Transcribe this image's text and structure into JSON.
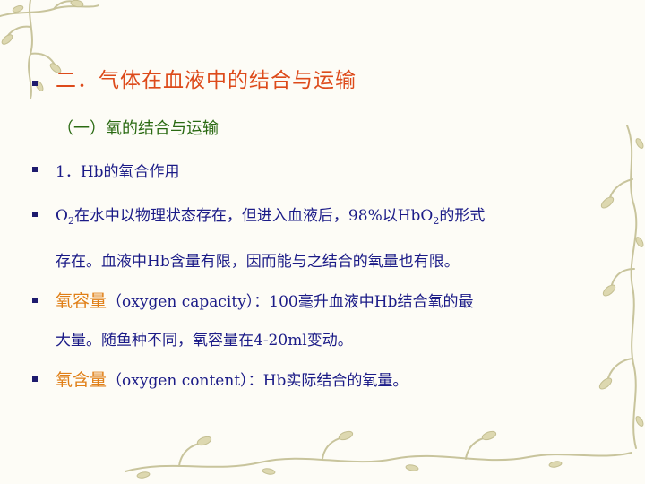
{
  "title": "二．气体在血液中的结合与运输",
  "subtitle": "（一）氧的结合与运输",
  "item1": "1．Hb的氧合作用",
  "item2": {
    "o2_main": "O",
    "o2_sub": "2",
    "text_a": "在水中以物理状态存在，但进入血液后，98%以HbO",
    "hbo2_sub": "2",
    "text_b": "的形式",
    "line2": "存在。血液中Hb含量有限，因而能与之结合的氧量也有限。"
  },
  "item3": {
    "term": "氧容量",
    "text_a": "（oxygen capacity）：100毫升血液中Hb结合氧的最",
    "line2": "大量。随鱼种不同，氧容量在4-20ml变动。"
  },
  "item4": {
    "term": "氧含量",
    "text_a": "（oxygen content）：Hb实际结合的氧量。"
  },
  "colors": {
    "title": "#dd4a1a",
    "subtitle": "#2a6a12",
    "body": "#1b1b87",
    "highlight": "#e07f17",
    "bullet": "#1e1b6e"
  }
}
